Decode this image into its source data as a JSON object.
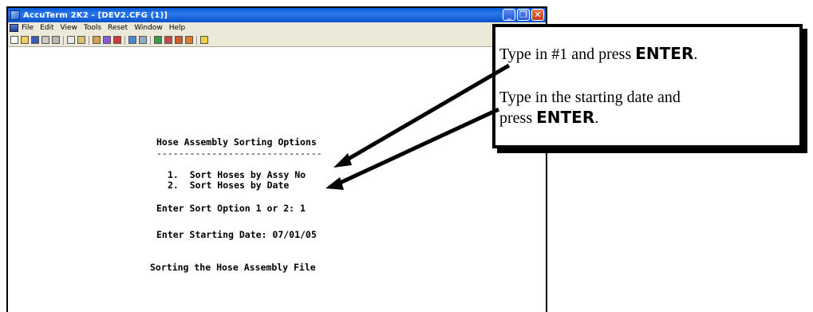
{
  "window": {
    "title": "AccuTerm 2K2 - [DEV2.CFG (1)]",
    "controls": [
      "_",
      "❐",
      "✕"
    ]
  },
  "menubar": {
    "items": [
      "File",
      "Edit",
      "View",
      "Tools",
      "Reset",
      "Window",
      "Help"
    ]
  },
  "terminal": {
    "heading": "Hose Assembly Sorting Options",
    "rule": "------------------------------",
    "options": [
      "1.  Sort Hoses by Assy No",
      "2.  Sort Hoses by Date"
    ],
    "prompt_sort": "Enter Sort Option 1 or 2: 1",
    "prompt_date": "Enter Starting Date: 07/01/05",
    "status": "Sorting the Hose Assembly File"
  },
  "callout": {
    "line1_prefix": "Type in #1 and press ",
    "line1_key": "ENTER",
    "line1_suffix": ".",
    "line2_text": "Type in the starting date and",
    "line3_prefix": "press ",
    "line3_key": "ENTER",
    "line3_suffix": "."
  },
  "colors": {
    "titlebar": "#0a5ad8",
    "menubar": "#ece9d8",
    "terminal_bg": "#ffffff",
    "terminal_text": "#000000"
  }
}
